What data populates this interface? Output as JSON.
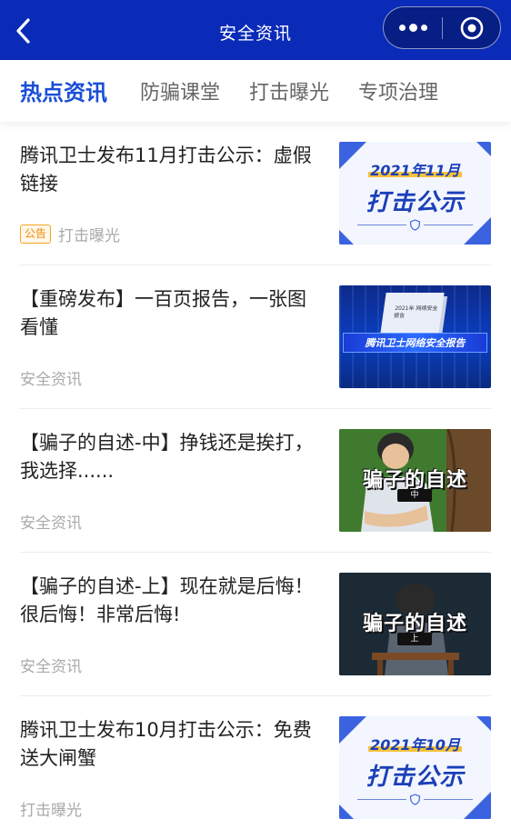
{
  "header": {
    "title": "安全资讯"
  },
  "tabs": [
    {
      "label": "热点资讯",
      "active": true
    },
    {
      "label": "防骗课堂",
      "active": false
    },
    {
      "label": "打击曝光",
      "active": false
    },
    {
      "label": "专项治理",
      "active": false
    }
  ],
  "articles": [
    {
      "title": "腾讯卫士发布11月打击公示：虚假链接",
      "badge": "公告",
      "category": "打击曝光",
      "thumb": {
        "kind": "announcement",
        "year_text": "2021年11月",
        "main_text": "打击公示"
      }
    },
    {
      "title": "【重磅发布】一百页报告，一张图看懂",
      "badge": "",
      "category": "安全资讯",
      "thumb": {
        "kind": "report",
        "band_text": "腾讯卫士网络安全报告",
        "book_text": "2021年 网络安全报告"
      }
    },
    {
      "title": "【骗子的自述-中】挣钱还是挨打，我选择......",
      "badge": "",
      "category": "安全资讯",
      "thumb": {
        "kind": "scam",
        "main_text": "骗子的自述",
        "sub_text": "中"
      }
    },
    {
      "title": "【骗子的自述-上】现在就是后悔！很后悔！非常后悔!",
      "badge": "",
      "category": "安全资讯",
      "thumb": {
        "kind": "scam-dark",
        "main_text": "骗子的自述",
        "sub_text": "上"
      }
    },
    {
      "title": "腾讯卫士发布10月打击公示：免费送大闸蟹",
      "badge": "",
      "category": "打击曝光",
      "thumb": {
        "kind": "announcement",
        "year_text": "2021年10月",
        "main_text": "打击公示"
      }
    }
  ],
  "colors": {
    "header_bg": "#0a2ab8",
    "tab_active": "#1a4fd6",
    "badge": "#f08a00"
  }
}
